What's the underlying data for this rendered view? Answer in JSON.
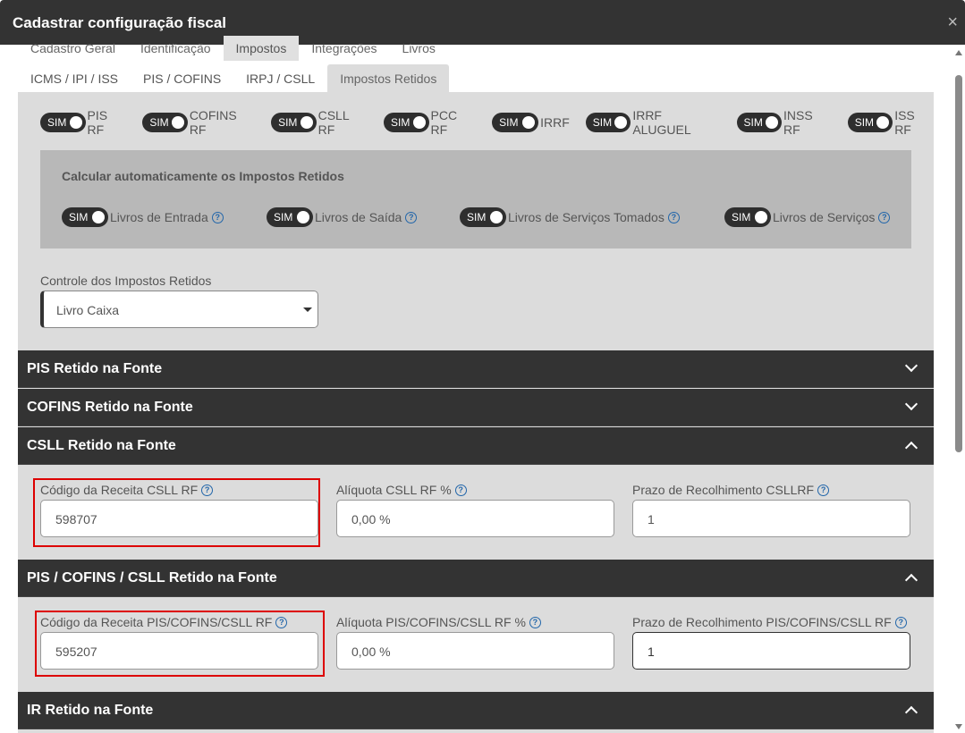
{
  "window": {
    "title": "Cadastrar configuração fiscal",
    "close": "×"
  },
  "tabs_primary": [
    "Cadastro Geral",
    "Identificação",
    "Impostos",
    "Integrações",
    "Livros"
  ],
  "tabs_secondary": [
    "ICMS / IPI / ISS",
    "PIS / COFINS",
    "IRPJ / CSLL",
    "Impostos Retidos"
  ],
  "toggles": [
    {
      "state": "SIM",
      "label": "PIS RF"
    },
    {
      "state": "SIM",
      "label": "COFINS RF"
    },
    {
      "state": "SIM",
      "label": "CSLL RF"
    },
    {
      "state": "SIM",
      "label": "PCC RF"
    },
    {
      "state": "SIM",
      "label": "IRRF"
    },
    {
      "state": "SIM",
      "label": "IRRF ALUGUEL"
    },
    {
      "state": "SIM",
      "label": "INSS RF"
    },
    {
      "state": "SIM",
      "label": "ISS RF"
    }
  ],
  "auto_calc": {
    "header": "Calcular automaticamente os Impostos Retidos",
    "items": [
      {
        "state": "SIM",
        "label": "Livros de Entrada"
      },
      {
        "state": "SIM",
        "label": "Livros de Saída"
      },
      {
        "state": "SIM",
        "label": "Livros de Serviços Tomados"
      },
      {
        "state": "SIM",
        "label": "Livros de Serviços"
      }
    ]
  },
  "controle": {
    "label": "Controle dos Impostos Retidos",
    "value": "Livro Caixa"
  },
  "sections": {
    "pis": "PIS Retido na Fonte",
    "cofins": "COFINS Retido na Fonte",
    "csll": "CSLL Retido na Fonte",
    "pcc": "PIS / COFINS / CSLL Retido na Fonte",
    "ir": "IR Retido na Fonte"
  },
  "csll_fields": {
    "codigo_label": "Código da Receita CSLL RF",
    "codigo_value": "598707",
    "aliquota_label": "Alíquota CSLL RF %",
    "aliquota_value": "0,00 %",
    "prazo_label": "Prazo de Recolhimento CSLLRF",
    "prazo_value": "1"
  },
  "pcc_fields": {
    "codigo_label": "Código da Receita PIS/COFINS/CSLL RF",
    "codigo_value": "595207",
    "aliquota_label": "Alíquota PIS/COFINS/CSLL RF %",
    "aliquota_value": "0,00 %",
    "prazo_label": "Prazo de Recolhimento PIS/COFINS/CSLL RF",
    "prazo_value": "1"
  },
  "colors": {
    "dark": "#333333",
    "panel": "#dcdcdc",
    "highlight": "#dd0000",
    "help": "#2266aa"
  }
}
